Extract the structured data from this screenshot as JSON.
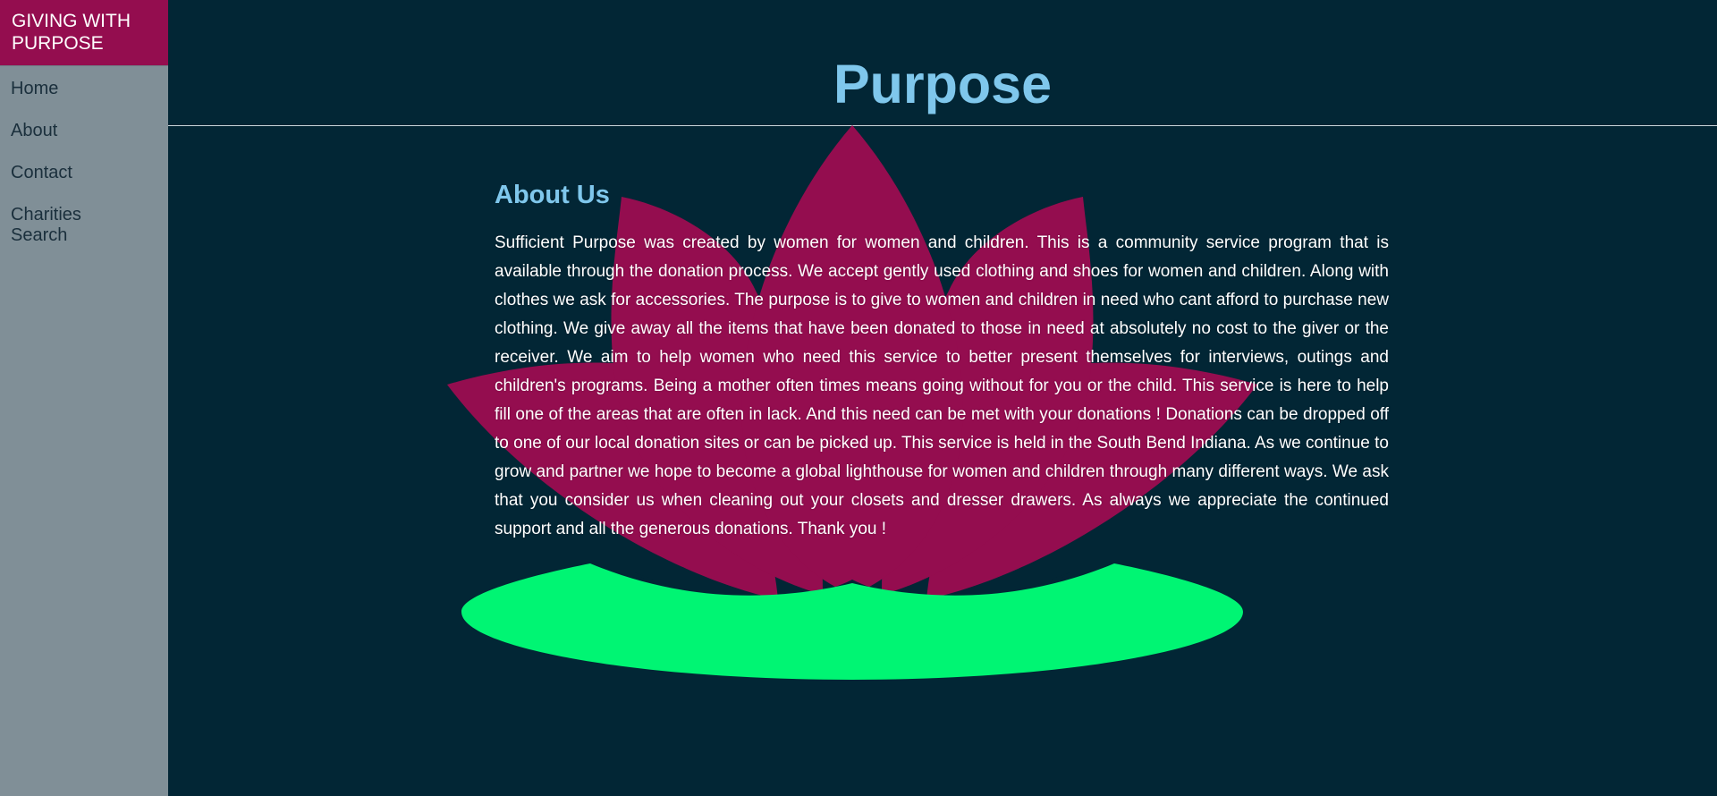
{
  "sidebar": {
    "brand": "GIVING WITH PURPOSE",
    "items": [
      {
        "label": "Home"
      },
      {
        "label": "About"
      },
      {
        "label": "Contact"
      },
      {
        "label": "Charities Search"
      }
    ]
  },
  "main": {
    "title": "Purpose",
    "section_heading": "About Us",
    "about_text": "Sufficient Purpose was created by women for women and children. This is a community service program that is available through the donation process. We accept gently used clothing and shoes for women and children. Along with clothes we ask for accessories. The purpose is to give to women and children in need who cant afford to purchase new clothing. We give away all the items that have been donated to those in need at absolutely no cost to the giver or the receiver. We aim to help women who need this service to better present themselves for interviews, outings and children's programs. Being a mother often times means going without for you or the child. This service is here to help fill one of the areas that are often in lack. And this need can be met with your donations ! Donations can be dropped off to one of our local donation sites or can be picked up. This service is held in the South Bend Indiana. As we continue to grow and partner we hope to become a global lighthouse for women and children through many different ways. We ask that you consider us when cleaning out your closets and dresser drawers. As always we appreciate the continued support and all the generous donations. Thank you !"
  },
  "colors": {
    "background": "#022635",
    "sidebar": "#808f97",
    "brand": "#940d4f",
    "accent": "#7fc7ec",
    "lotus_petal": "#940d4f",
    "lotus_leaf": "#00f573"
  },
  "icons": {
    "background_art": "lotus-icon"
  }
}
